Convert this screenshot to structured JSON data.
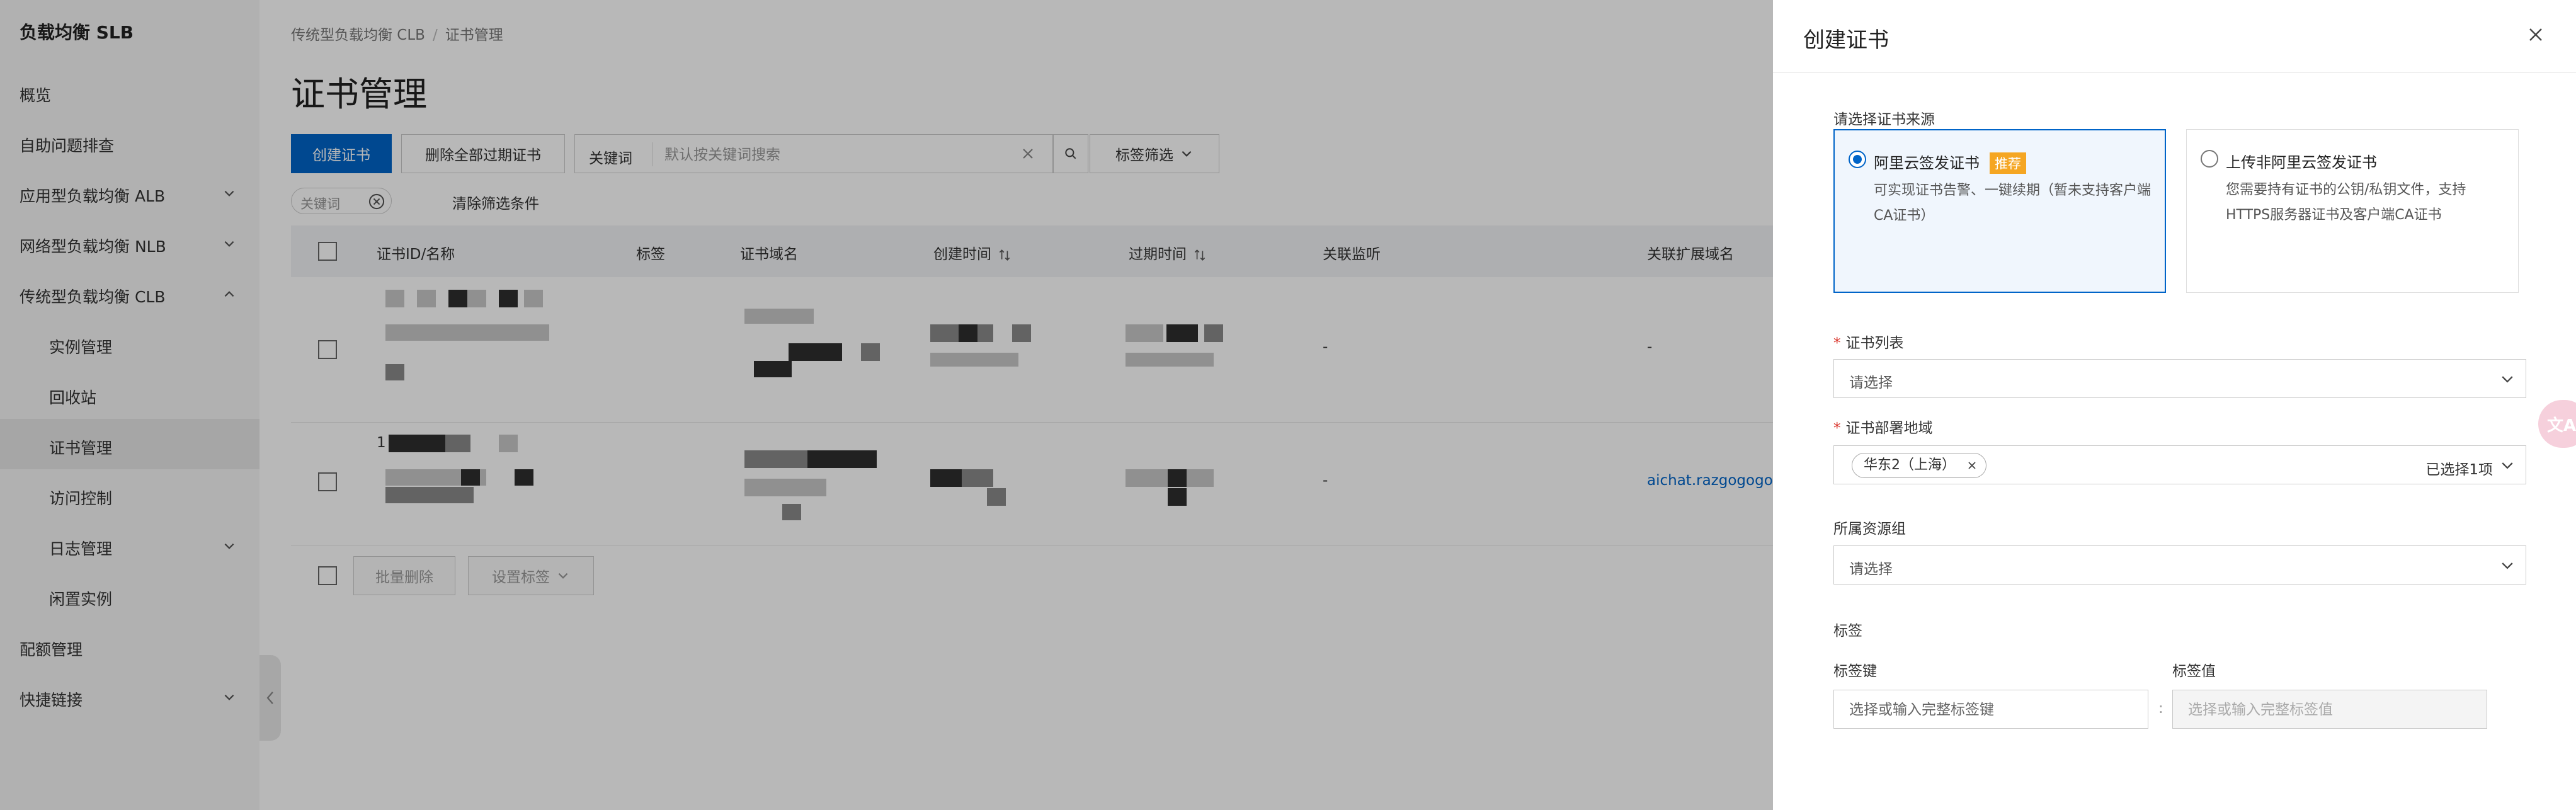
{
  "sidebar": {
    "title": "负载均衡 SLB",
    "items": [
      {
        "label": "概览"
      },
      {
        "label": "自助问题排查"
      },
      {
        "label": "应用型负载均衡 ALB"
      },
      {
        "label": "网络型负载均衡 NLB"
      },
      {
        "label": "传统型负载均衡 CLB"
      },
      {
        "label": "实例管理"
      },
      {
        "label": "回收站"
      },
      {
        "label": "证书管理"
      },
      {
        "label": "访问控制"
      },
      {
        "label": "日志管理"
      },
      {
        "label": "闲置实例"
      },
      {
        "label": "配额管理"
      },
      {
        "label": "快捷链接"
      }
    ]
  },
  "breadcrumb": {
    "parent": "传统型负载均衡 CLB",
    "sep": "/",
    "current": "证书管理"
  },
  "page": {
    "title": "证书管理"
  },
  "toolbar": {
    "create_label": "创建证书",
    "delete_expired_label": "删除全部过期证书",
    "keyword_label": "关键词",
    "keyword_placeholder": "默认按关键词搜索",
    "tag_filter_label": "标签筛选"
  },
  "filter": {
    "chip_label": "关键词",
    "clear_label": "清除筛选条件"
  },
  "table": {
    "columns": [
      "证书ID/名称",
      "标签",
      "证书域名",
      "创建时间",
      "过期时间",
      "关联监听",
      "关联扩展域名"
    ],
    "rows": [
      {
        "listener": "-",
        "ext_domain": "-"
      },
      {
        "id_prefix": "1",
        "listener": "-",
        "ext_domain": "aichat.razgogogo"
      }
    ]
  },
  "footer": {
    "batch_delete_label": "批量删除",
    "set_tag_label": "设置标签"
  },
  "drawer": {
    "title": "创建证书",
    "source_label": "请选择证书来源",
    "source_options": [
      {
        "title": "阿里云签发证书",
        "badge": "推荐",
        "desc": "可实现证书告警、一键续期（暂未支持客户端CA证书）"
      },
      {
        "title": "上传非阿里云签发证书",
        "desc": "您需要持有证书的公钥/私钥文件，支持HTTPS服务器证书及客户端CA证书"
      }
    ],
    "cert_list_label": "证书列表",
    "cert_list_placeholder": "请选择",
    "region_label": "证书部署地域",
    "region_tag": "华东2（上海）",
    "region_count": "已选择1项",
    "resource_group_label": "所属资源组",
    "resource_group_placeholder": "请选择",
    "tags_label": "标签",
    "tag_key_label": "标签键",
    "tag_value_label": "标签值",
    "tag_key_placeholder": "选择或输入完整标签键",
    "tag_value_placeholder": "选择或输入完整标签值",
    "tag_sep": ":"
  },
  "float_button": {
    "label": "文A"
  },
  "colors": {
    "primary": "#0064c8",
    "badge": "#f5a623",
    "required": "#d93026"
  }
}
